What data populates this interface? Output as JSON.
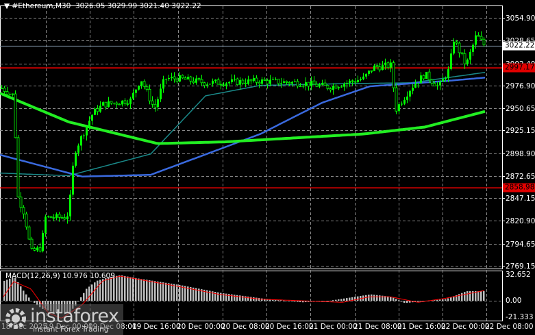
{
  "header": {
    "symbol": "#Ethereum,M30",
    "open": "3026.05",
    "high": "3029.99",
    "low": "3021.40",
    "close": "3022.22"
  },
  "price_axis": {
    "ticks": [
      "3054.90",
      "3028.65",
      "3002.40",
      "2976.90",
      "2950.65",
      "2925.15",
      "2898.90",
      "2872.65",
      "2847.15",
      "2820.90",
      "2794.65",
      "2769.15"
    ],
    "current_price": "3022.22",
    "levels": [
      "2997.17",
      "2858.98"
    ]
  },
  "time_axis": [
    "18 Dec 2025",
    "19 Dec 00:00",
    "19 Dec 08:00",
    "19 Dec 16:00",
    "20 Dec 00:00",
    "20 Dec 08:00",
    "20 Dec 16:00",
    "21 Dec 00:00",
    "21 Dec 08:00",
    "21 Dec 16:00",
    "22 Dec 00:00",
    "22 Dec 08:00"
  ],
  "macd": {
    "label": "MACD(12,26,9) 10.976 10.609",
    "ticks": [
      "32.652",
      "0.00",
      "-21.333"
    ]
  },
  "watermark": {
    "brand": "instaforex",
    "tagline": "Instant Forex Trading"
  },
  "colors": {
    "up": "#00ff00",
    "down": "#00ff00",
    "level": "#ff0000",
    "ma_slow": "#22ee22",
    "ma_mid": "#3a6adf",
    "ma_fast": "#1a8a8a",
    "hist": "#bdbdbd",
    "signal": "#ff0000"
  },
  "chart_data": {
    "type": "candlestick",
    "price_range": [
      2769.15,
      3054.9
    ],
    "price_path": [
      [
        0,
        2975
      ],
      [
        20,
        2965
      ],
      [
        25,
        2850
      ],
      [
        35,
        2830
      ],
      [
        45,
        2785
      ],
      [
        60,
        2790
      ],
      [
        65,
        2825
      ],
      [
        95,
        2825
      ],
      [
        100,
        2830
      ],
      [
        108,
        2900
      ],
      [
        120,
        2920
      ],
      [
        135,
        2945
      ],
      [
        150,
        2955
      ],
      [
        190,
        2960
      ],
      [
        205,
        2985
      ],
      [
        225,
        2950
      ],
      [
        240,
        2985
      ],
      [
        260,
        2985
      ],
      [
        300,
        2980
      ],
      [
        380,
        2982
      ],
      [
        440,
        2980
      ],
      [
        480,
        2975
      ],
      [
        530,
        2985
      ],
      [
        545,
        2998
      ],
      [
        570,
        3000
      ],
      [
        578,
        2950
      ],
      [
        600,
        2975
      ],
      [
        620,
        2990
      ],
      [
        640,
        2975
      ],
      [
        655,
        2995
      ],
      [
        662,
        3030
      ],
      [
        680,
        3000
      ],
      [
        695,
        3035
      ],
      [
        708,
        3022
      ]
    ],
    "ma_slow": [
      [
        0,
        2968
      ],
      [
        100,
        2935
      ],
      [
        230,
        2910
      ],
      [
        330,
        2912
      ],
      [
        530,
        2921
      ],
      [
        620,
        2929
      ],
      [
        708,
        2947
      ]
    ],
    "ma_mid": [
      [
        0,
        2897
      ],
      [
        120,
        2872
      ],
      [
        220,
        2874
      ],
      [
        380,
        2921
      ],
      [
        470,
        2957
      ],
      [
        540,
        2976
      ],
      [
        650,
        2982
      ],
      [
        708,
        2986
      ]
    ],
    "ma_fast": [
      [
        0,
        2876
      ],
      [
        100,
        2873
      ],
      [
        220,
        2898
      ],
      [
        300,
        2965
      ],
      [
        380,
        2977
      ],
      [
        500,
        2979
      ],
      [
        600,
        2980
      ],
      [
        708,
        2992
      ]
    ],
    "macd_range": [
      -21.333,
      32.652
    ],
    "macd_hist": [
      [
        5,
        25
      ],
      [
        20,
        30
      ],
      [
        35,
        10
      ],
      [
        45,
        0
      ],
      [
        60,
        -10
      ],
      [
        80,
        -15
      ],
      [
        100,
        -15
      ],
      [
        110,
        -5
      ],
      [
        125,
        15
      ],
      [
        140,
        25
      ],
      [
        160,
        30
      ],
      [
        175,
        32
      ],
      [
        200,
        28
      ],
      [
        260,
        20
      ],
      [
        320,
        10
      ],
      [
        380,
        3
      ],
      [
        440,
        -2
      ],
      [
        480,
        0
      ],
      [
        540,
        8
      ],
      [
        570,
        5
      ],
      [
        590,
        -3
      ],
      [
        620,
        0
      ],
      [
        650,
        2
      ],
      [
        680,
        12
      ],
      [
        708,
        12
      ]
    ],
    "macd_signal": [
      [
        5,
        5
      ],
      [
        20,
        24
      ],
      [
        45,
        15
      ],
      [
        70,
        -15
      ],
      [
        90,
        -22
      ],
      [
        120,
        -5
      ],
      [
        150,
        25
      ],
      [
        175,
        31
      ],
      [
        260,
        18
      ],
      [
        320,
        8
      ],
      [
        380,
        2
      ],
      [
        440,
        0
      ],
      [
        500,
        -2
      ],
      [
        540,
        5
      ],
      [
        570,
        5
      ],
      [
        610,
        -2
      ],
      [
        650,
        3
      ],
      [
        708,
        13
      ]
    ]
  }
}
